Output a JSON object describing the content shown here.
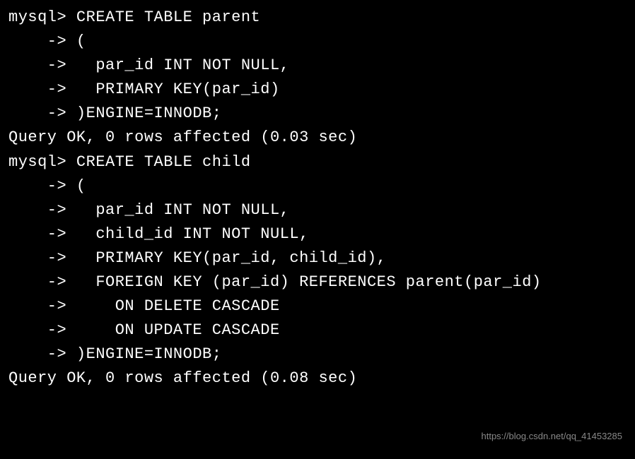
{
  "terminal": {
    "lines": [
      "mysql> CREATE TABLE parent",
      "    -> (",
      "    ->   par_id INT NOT NULL,",
      "    ->   PRIMARY KEY(par_id)",
      "    -> )ENGINE=INNODB;",
      "Query OK, 0 rows affected (0.03 sec)",
      "",
      "mysql> CREATE TABLE child",
      "    -> (",
      "    ->   par_id INT NOT NULL,",
      "    ->   child_id INT NOT NULL,",
      "    ->   PRIMARY KEY(par_id, child_id),",
      "    ->   FOREIGN KEY (par_id) REFERENCES parent(par_id)",
      "    ->     ON DELETE CASCADE",
      "    ->     ON UPDATE CASCADE",
      "    -> )ENGINE=INNODB;",
      "Query OK, 0 rows affected (0.08 sec)"
    ]
  },
  "watermark": "https://blog.csdn.net/qq_41453285"
}
